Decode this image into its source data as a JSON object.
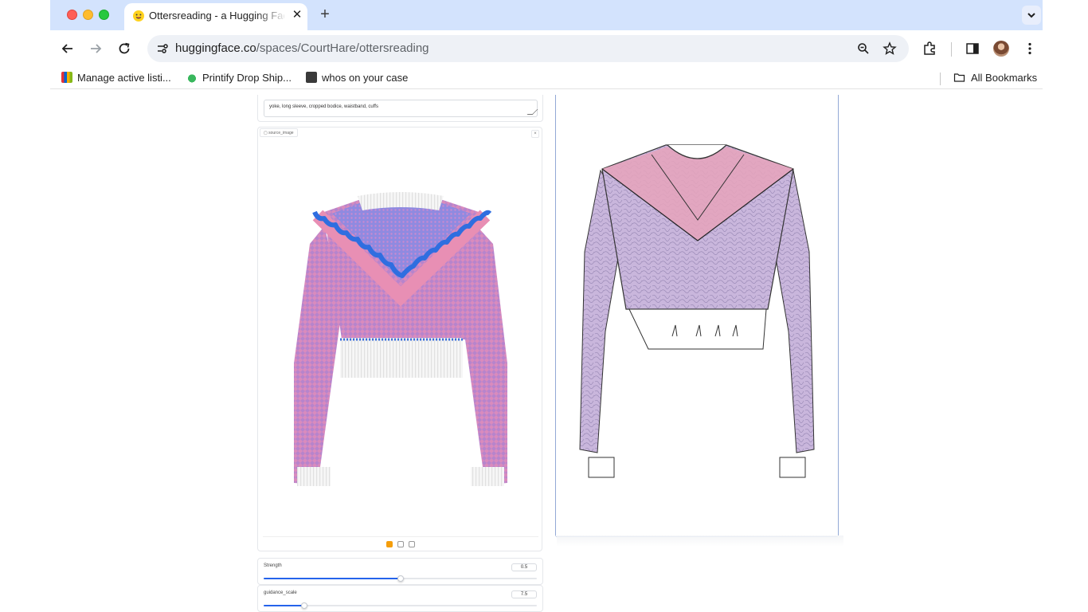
{
  "browser": {
    "tab": {
      "title": "Ottersreading - a Hugging Face Space by CourtHare",
      "favicon": "hugging-face-icon"
    },
    "address": {
      "domain": "huggingface.co",
      "path": "/spaces/CourtHare/ottersreading"
    },
    "bookmarks": [
      {
        "label": "Manage active listi...",
        "icon": "shop-icon"
      },
      {
        "label": "Printify Drop Ship...",
        "icon": "printify-icon"
      },
      {
        "label": "whos on your case",
        "icon": "cube-icon"
      }
    ],
    "all_bookmarks": "All Bookmarks"
  },
  "app": {
    "prompt_value": "yoke, long sleeve, cropped bodice, waistband, cuffs",
    "image_label": "source_image",
    "image_description": "pink and blue knit cropped sweater with ruffled yoke",
    "output_description": "sketch of cropped sweater",
    "sliders": [
      {
        "label": "Strength",
        "value": "0.5",
        "fraction": 0.5
      },
      {
        "label": "guidance_scale",
        "value": "7.5",
        "fraction": 0.15
      }
    ]
  },
  "colors": {
    "accent": "#2563eb",
    "tabstrip": "#d3e3fd",
    "sweater_pink": "#e08ab0",
    "sweater_blue": "#3b6fd8"
  }
}
